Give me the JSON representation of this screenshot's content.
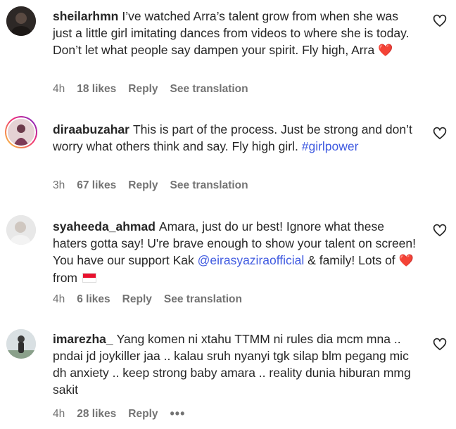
{
  "comments": [
    {
      "username": "sheilarhmn",
      "text": "I’ve watched Arra’s talent grow from when she was just a little girl imitating dances from videos to where she is today. Don’t let what people say dampen your spirit. Fly high, Arra",
      "emoji": "❤️",
      "time": "4h",
      "likes": "18 likes",
      "reply": "Reply",
      "translation": "See translation"
    },
    {
      "username": "diraabuzahar",
      "text": "This is part of the process. Just be strong and don’t worry what others think and say. Fly high girl.",
      "hashtag": "#girlpower",
      "time": "3h",
      "likes": "67 likes",
      "reply": "Reply",
      "translation": "See translation"
    },
    {
      "username": "syaheeda_ahmad",
      "text": "Amara, just do ur best! Ignore what these haters gotta say! U're brave enough to show your talent on screen! You have our support Kak",
      "mention": "@eirasyaziraofficial",
      "text2": "& family! Lots of",
      "emoji": "❤️",
      "text3": "from",
      "time": "4h",
      "likes": "6 likes",
      "reply": "Reply",
      "translation": "See translation"
    },
    {
      "username": "imarezha_",
      "text": "Yang komen ni xtahu TTMM ni rules dia mcm mna .. pndai jd joykiller jaa .. kalau sruh nyanyi tgk silap blm pegang mic dh anxiety .. keep strong baby amara .. reality dunia hiburan mmg sakit",
      "time": "4h",
      "likes": "28 likes",
      "reply": "Reply",
      "more": "•••"
    }
  ],
  "icons": {
    "like": "heart-outline-icon",
    "more": "more-options-icon"
  },
  "colors": {
    "link": "#3f5ae0",
    "meta": "#737373",
    "text": "#262626"
  }
}
